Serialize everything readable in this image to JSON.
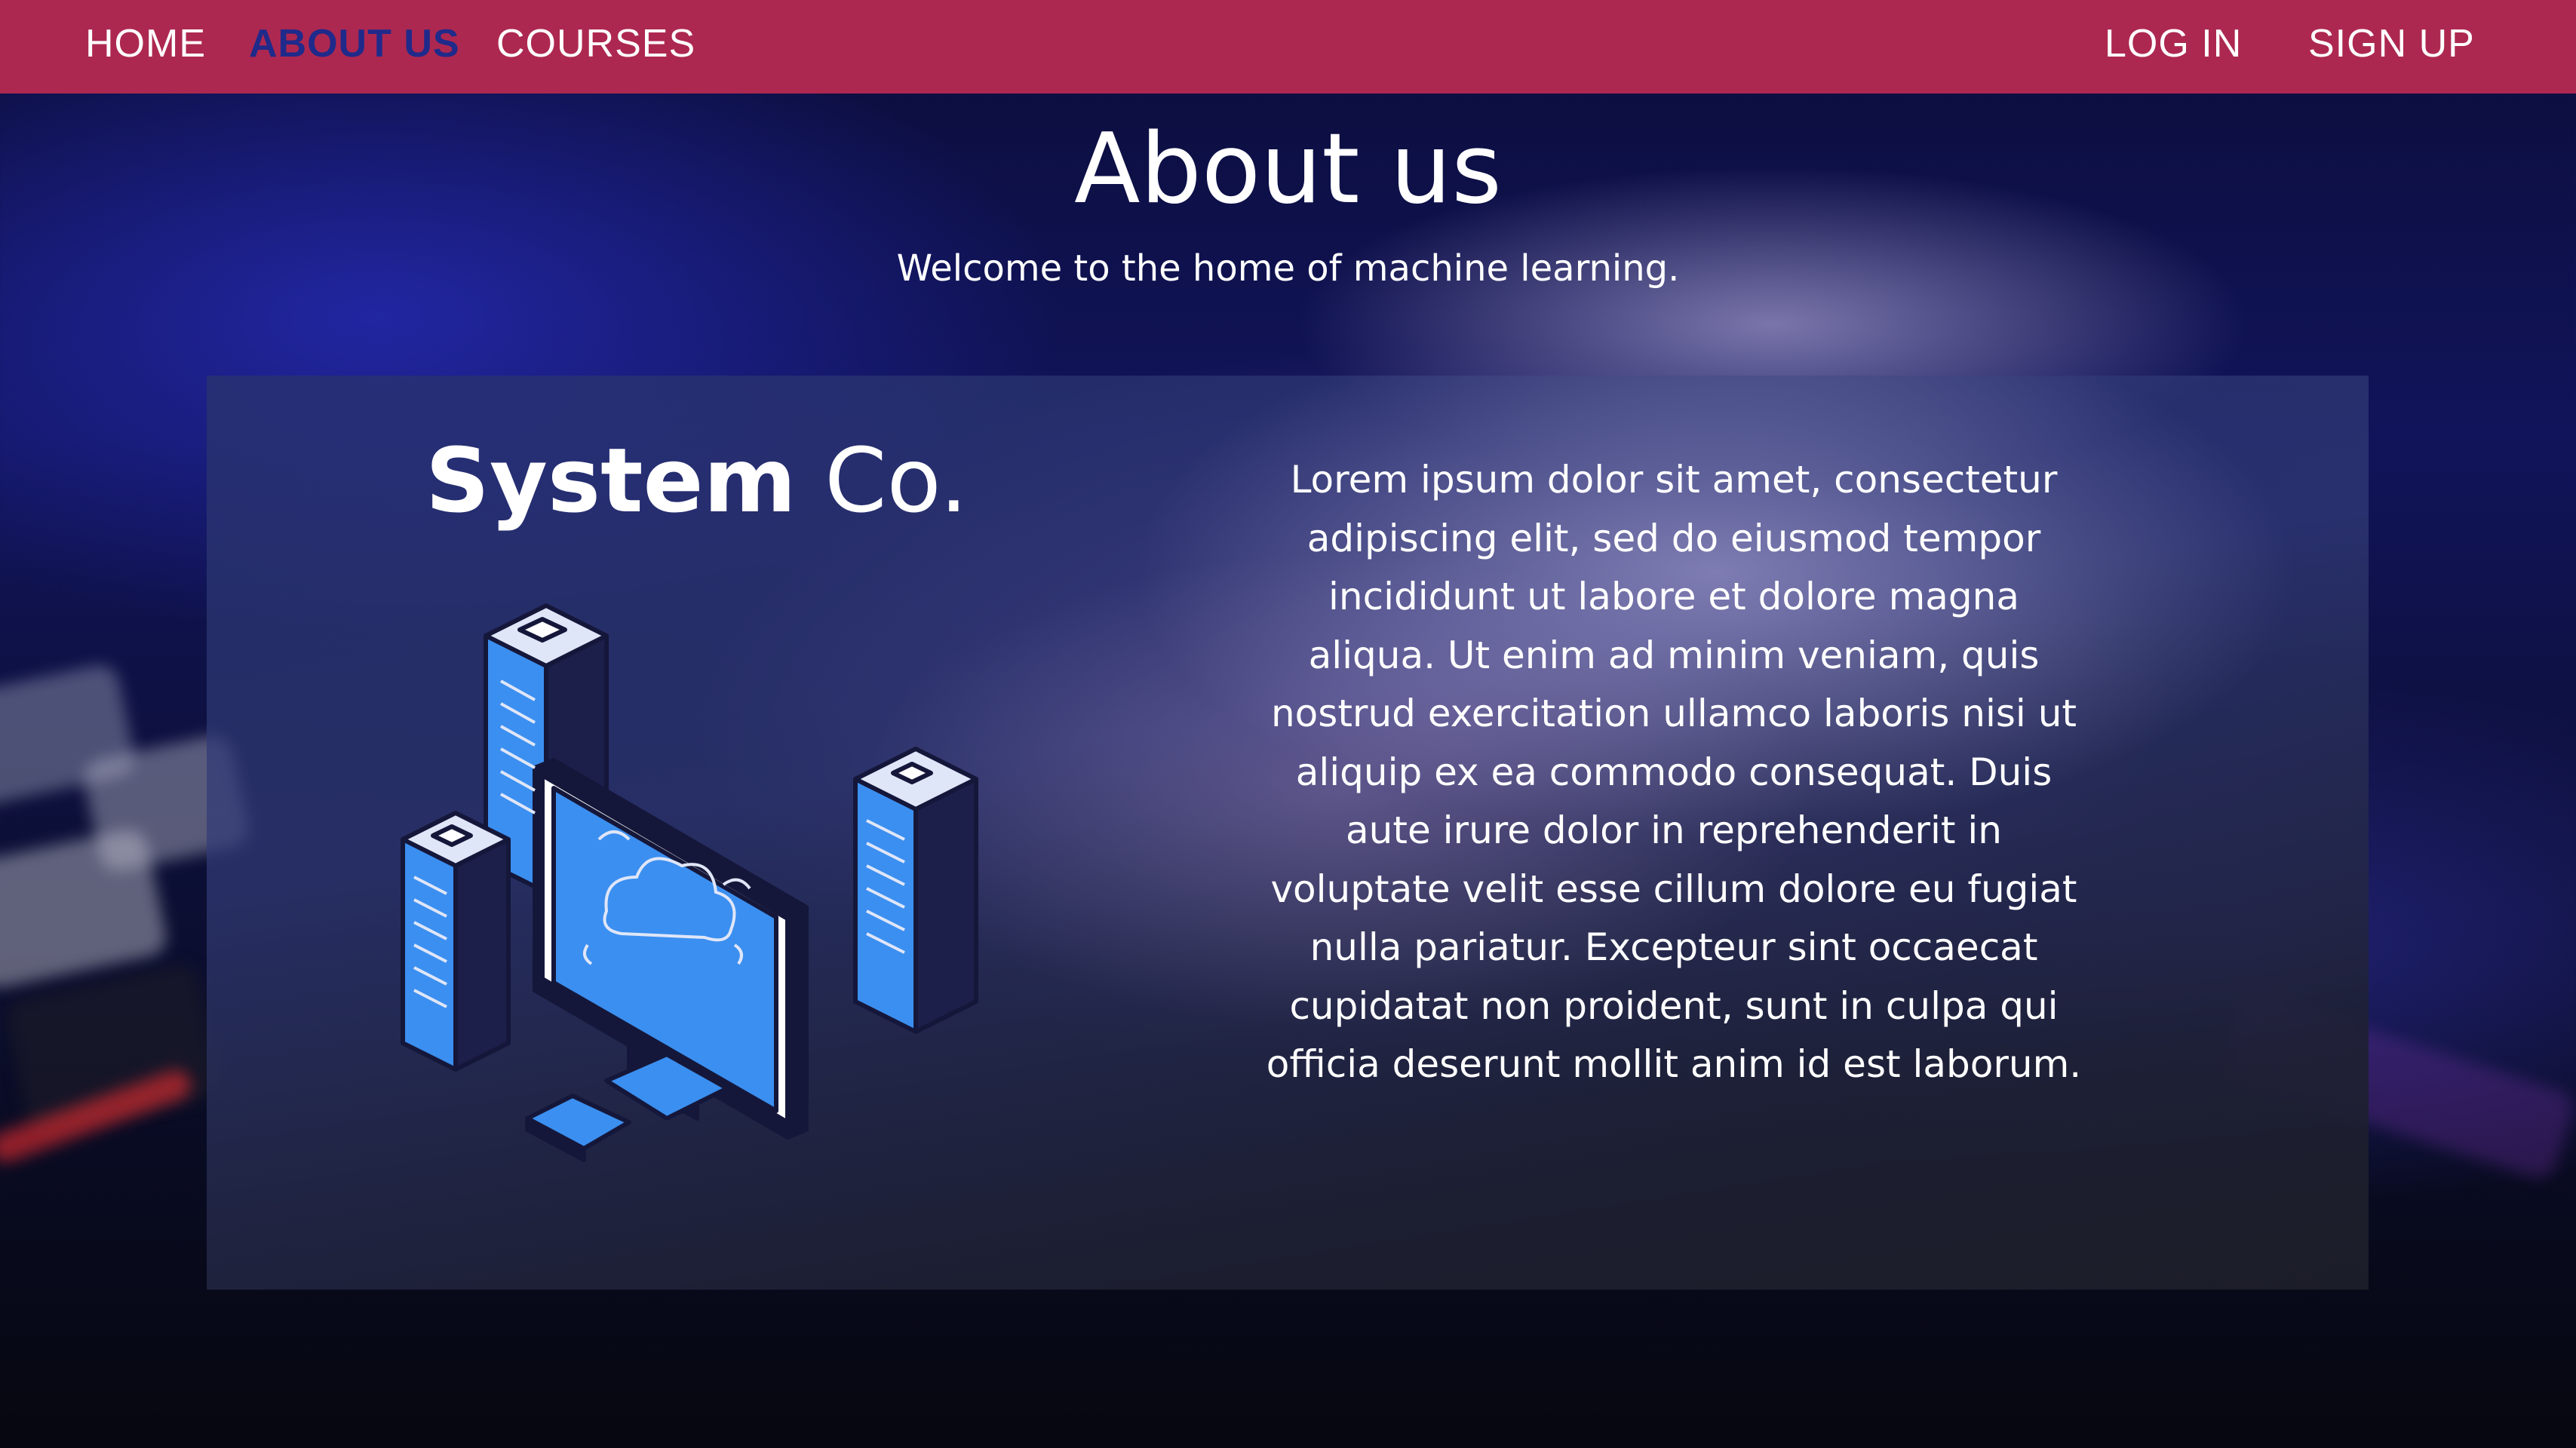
{
  "nav": {
    "home": "HOME",
    "about": "ABOUT US",
    "courses": "COURSES",
    "login": "LOG IN",
    "signup": "SIGN UP"
  },
  "hero": {
    "title": "About us",
    "subtitle": "Welcome to the home of machine learning."
  },
  "card": {
    "brand_bold": "System",
    "brand_light": "Co.",
    "illustration_icon": "server-cloud-illustration-icon",
    "body": "Lorem ipsum dolor sit amet, consectetur adipiscing elit, sed do eiusmod tempor incididunt ut labore et dolore magna aliqua. Ut enim ad minim veniam, quis nostrud exercitation ullamco laboris nisi ut aliquip ex ea commodo consequat. Duis aute irure dolor in reprehenderit in voluptate velit esse cillum dolore eu fugiat nulla pariatur. Excepteur sint occaecat cupidatat non proident, sunt in culpa qui officia deserunt mollit anim id est laborum."
  },
  "colors": {
    "navbar": "#ad2850",
    "nav_active": "#1f2a8a",
    "text": "#ffffff",
    "illustration_blue": "#3b8ff0",
    "illustration_dark": "#15173a"
  }
}
